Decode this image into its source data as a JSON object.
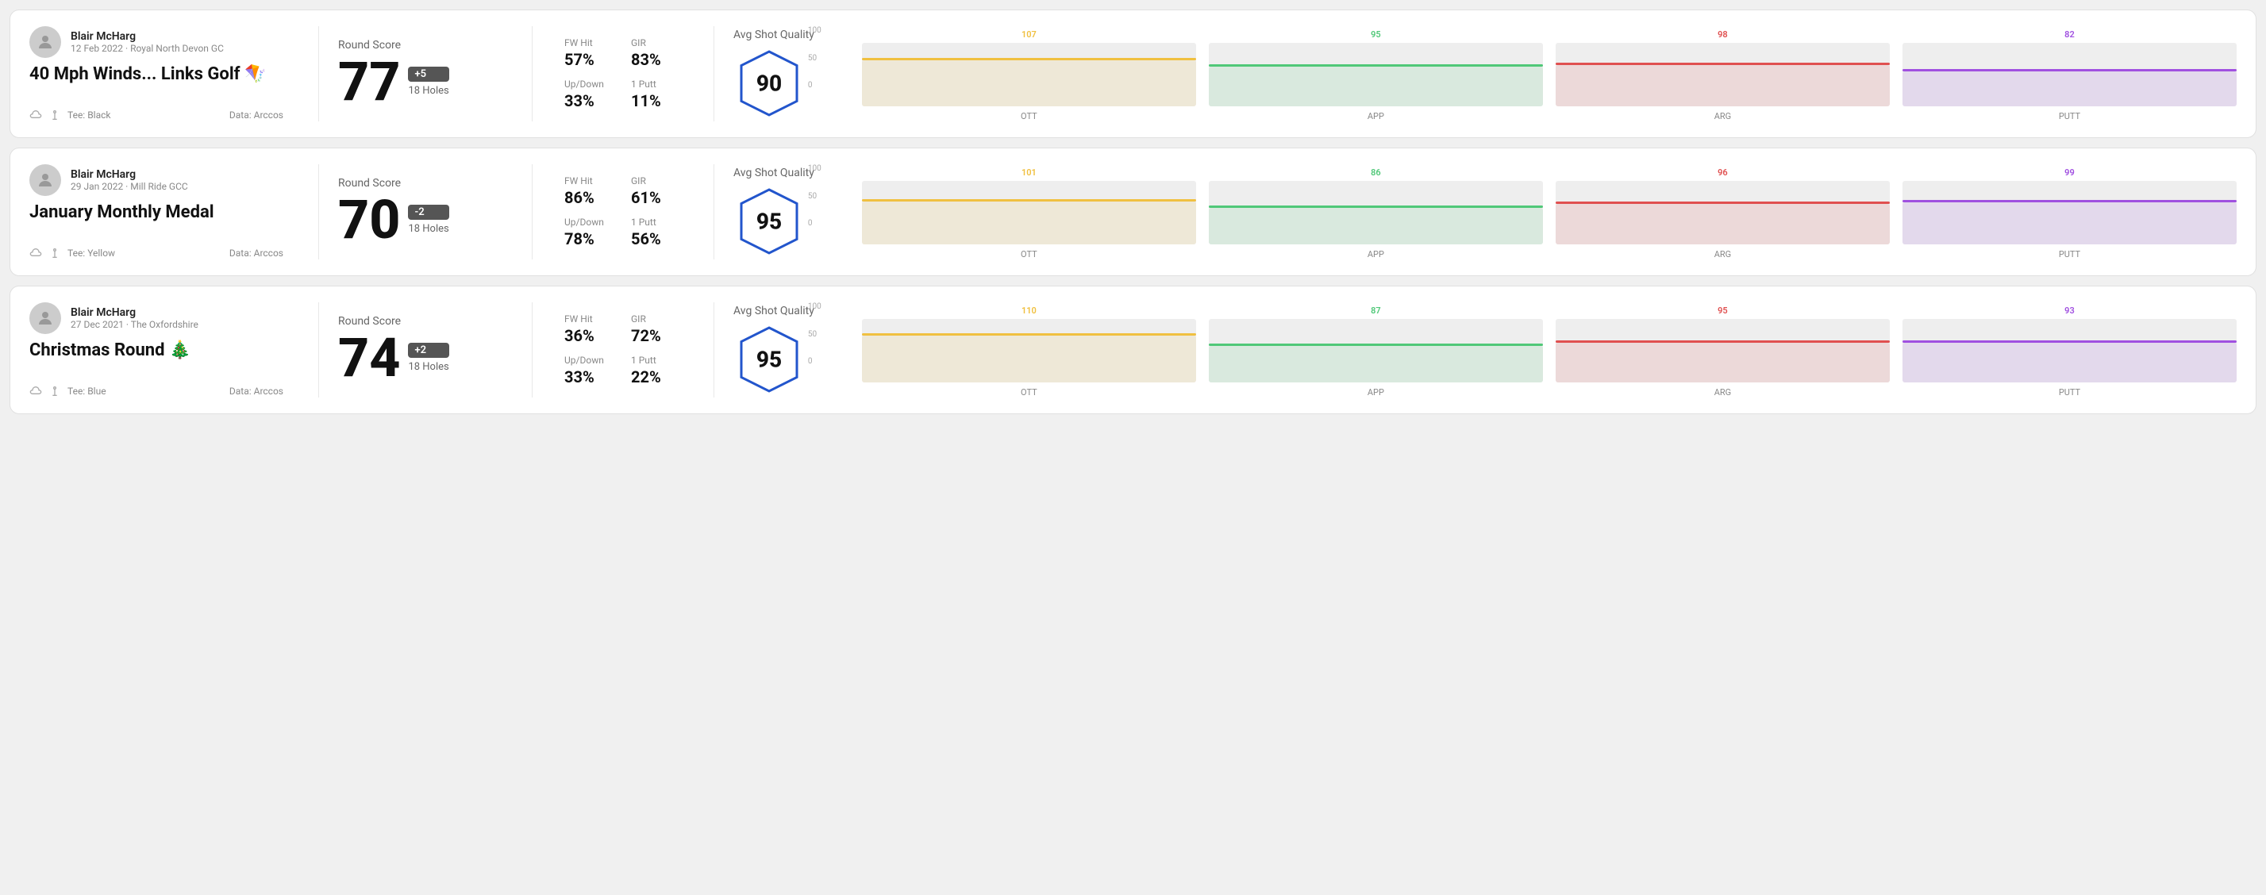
{
  "rounds": [
    {
      "id": "round-1",
      "user": {
        "name": "Blair McHarg",
        "date": "12 Feb 2022 · Royal North Devon GC"
      },
      "title": "40 Mph Winds... Links Golf 🪁",
      "tee": "Tee: Black",
      "data_source": "Data: Arccos",
      "score": {
        "label": "Round Score",
        "number": "77",
        "badge": "+5",
        "holes": "18 Holes"
      },
      "stats": {
        "fw_hit_label": "FW Hit",
        "fw_hit_value": "57%",
        "gir_label": "GIR",
        "gir_value": "83%",
        "updown_label": "Up/Down",
        "updown_value": "33%",
        "oneputt_label": "1 Putt",
        "oneputt_value": "11%"
      },
      "quality": {
        "label": "Avg Shot Quality",
        "score": "90"
      },
      "chart": {
        "columns": [
          {
            "label": "OTT",
            "value": 107,
            "color": "#f0c040",
            "bar_pct": 72
          },
          {
            "label": "APP",
            "value": 95,
            "color": "#50c878",
            "bar_pct": 62
          },
          {
            "label": "ARG",
            "value": 98,
            "color": "#e05050",
            "bar_pct": 65
          },
          {
            "label": "PUTT",
            "value": 82,
            "color": "#a050e0",
            "bar_pct": 55
          }
        ]
      }
    },
    {
      "id": "round-2",
      "user": {
        "name": "Blair McHarg",
        "date": "29 Jan 2022 · Mill Ride GCC"
      },
      "title": "January Monthly Medal",
      "tee": "Tee: Yellow",
      "data_source": "Data: Arccos",
      "score": {
        "label": "Round Score",
        "number": "70",
        "badge": "-2",
        "holes": "18 Holes"
      },
      "stats": {
        "fw_hit_label": "FW Hit",
        "fw_hit_value": "86%",
        "gir_label": "GIR",
        "gir_value": "61%",
        "updown_label": "Up/Down",
        "updown_value": "78%",
        "oneputt_label": "1 Putt",
        "oneputt_value": "56%"
      },
      "quality": {
        "label": "Avg Shot Quality",
        "score": "95"
      },
      "chart": {
        "columns": [
          {
            "label": "OTT",
            "value": 101,
            "color": "#f0c040",
            "bar_pct": 68
          },
          {
            "label": "APP",
            "value": 86,
            "color": "#50c878",
            "bar_pct": 57
          },
          {
            "label": "ARG",
            "value": 96,
            "color": "#e05050",
            "bar_pct": 64
          },
          {
            "label": "PUTT",
            "value": 99,
            "color": "#a050e0",
            "bar_pct": 66
          }
        ]
      }
    },
    {
      "id": "round-3",
      "user": {
        "name": "Blair McHarg",
        "date": "27 Dec 2021 · The Oxfordshire"
      },
      "title": "Christmas Round 🎄",
      "tee": "Tee: Blue",
      "data_source": "Data: Arccos",
      "score": {
        "label": "Round Score",
        "number": "74",
        "badge": "+2",
        "holes": "18 Holes"
      },
      "stats": {
        "fw_hit_label": "FW Hit",
        "fw_hit_value": "36%",
        "gir_label": "GIR",
        "gir_value": "72%",
        "updown_label": "Up/Down",
        "updown_value": "33%",
        "oneputt_label": "1 Putt",
        "oneputt_value": "22%"
      },
      "quality": {
        "label": "Avg Shot Quality",
        "score": "95"
      },
      "chart": {
        "columns": [
          {
            "label": "OTT",
            "value": 110,
            "color": "#f0c040",
            "bar_pct": 74
          },
          {
            "label": "APP",
            "value": 87,
            "color": "#50c878",
            "bar_pct": 58
          },
          {
            "label": "ARG",
            "value": 95,
            "color": "#e05050",
            "bar_pct": 63
          },
          {
            "label": "PUTT",
            "value": 93,
            "color": "#a050e0",
            "bar_pct": 62
          }
        ]
      }
    }
  ],
  "y_axis_labels": [
    "100",
    "50",
    "0"
  ]
}
